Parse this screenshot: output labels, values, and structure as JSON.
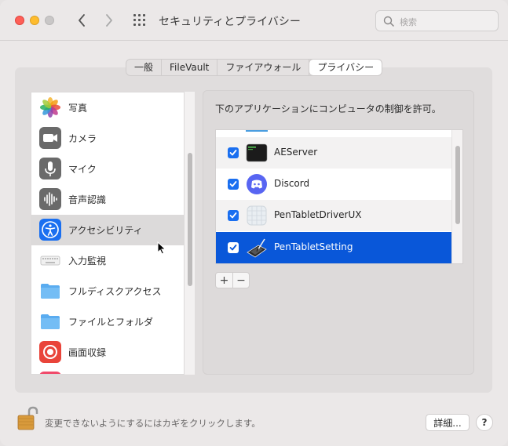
{
  "window": {
    "title": "セキュリティとプライバシー",
    "search_placeholder": "検索"
  },
  "tabs": [
    {
      "label": "一般",
      "active": false
    },
    {
      "label": "FileVault",
      "active": false
    },
    {
      "label": "ファイアウォール",
      "active": false
    },
    {
      "label": "プライバシー",
      "active": true
    }
  ],
  "sidebar": {
    "items": [
      {
        "label": "写真",
        "icon": "photos-icon",
        "selected": false
      },
      {
        "label": "カメラ",
        "icon": "camera-icon",
        "selected": false
      },
      {
        "label": "マイク",
        "icon": "microphone-icon",
        "selected": false
      },
      {
        "label": "音声認識",
        "icon": "speech-recognition-icon",
        "selected": false
      },
      {
        "label": "アクセシビリティ",
        "icon": "accessibility-icon",
        "selected": true
      },
      {
        "label": "入力監視",
        "icon": "keyboard-icon",
        "selected": false
      },
      {
        "label": "フルディスクアクセス",
        "icon": "folder-icon",
        "selected": false
      },
      {
        "label": "ファイルとフォルダ",
        "icon": "folder-icon",
        "selected": false
      },
      {
        "label": "画面収録",
        "icon": "screen-recording-icon",
        "selected": false
      }
    ]
  },
  "main": {
    "description": "下のアプリケーションにコンピュータの制御を許可。",
    "apps": [
      {
        "name": "AEServer",
        "checked": true,
        "icon": "terminal-icon",
        "selected": false
      },
      {
        "name": "Discord",
        "checked": true,
        "icon": "discord-icon",
        "selected": false
      },
      {
        "name": "PenTabletDriverUX",
        "checked": true,
        "icon": "generic-app-icon",
        "selected": false
      },
      {
        "name": "PenTabletSetting",
        "checked": true,
        "icon": "pen-tablet-icon",
        "selected": true
      }
    ],
    "add_label": "+",
    "remove_label": "−"
  },
  "footer": {
    "lock_text": "変更できないようにするにはカギをクリックします。",
    "details_label": "詳細...",
    "help_label": "?"
  },
  "colors": {
    "accent": "#0957d9",
    "checkbox": "#1a6ff0",
    "close": "#fe5f57",
    "minimize": "#febc2e"
  }
}
